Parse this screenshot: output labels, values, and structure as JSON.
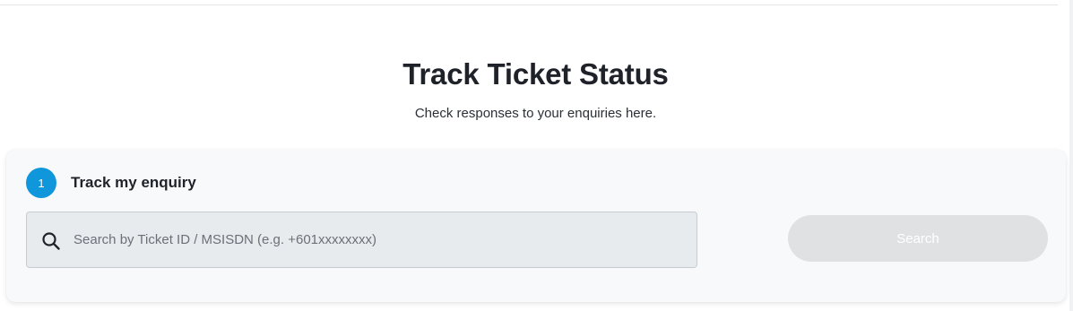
{
  "header": {
    "title": "Track Ticket Status",
    "subtitle": "Check responses to your enquiries here."
  },
  "enquiry_card": {
    "step_number": "1",
    "step_title": "Track my enquiry",
    "search": {
      "value": "",
      "placeholder": "Search by Ticket ID / MSISDN (e.g. +601xxxxxxxx)",
      "icon": "search-icon"
    },
    "search_button_label": "Search"
  },
  "colors": {
    "accent": "#0f96db",
    "button_disabled": "#e0e1e3",
    "input_bg": "#e8ebee",
    "card_bg": "#f8f9fa"
  }
}
